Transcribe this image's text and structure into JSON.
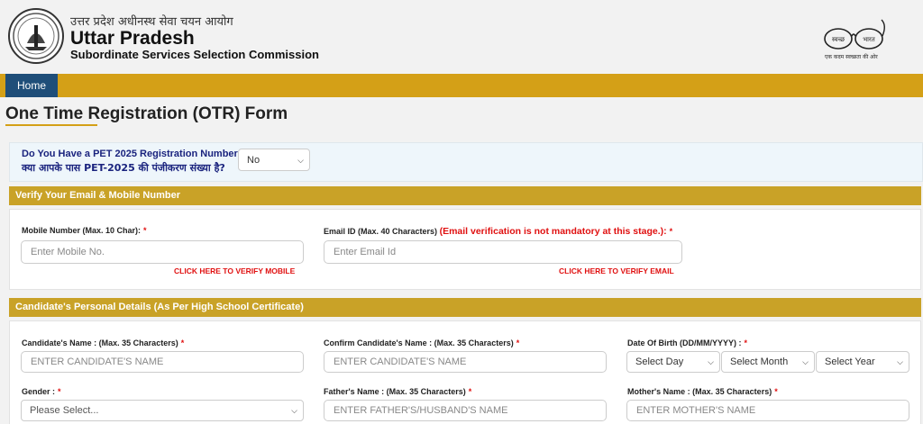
{
  "header": {
    "hindi_org": "उत्तर प्रदेश अधीनस्थ सेवा चयन आयोग",
    "title": "Uttar Pradesh",
    "subtitle": "Subordinate Services Selection Commission",
    "swachh_left": "स्वच्छ",
    "swachh_right": "भारत",
    "swachh_tagline": "एक कदम स्वच्छता की ओर"
  },
  "nav": {
    "home_label": "Home"
  },
  "page": {
    "title": "One Time Registration (OTR) Form"
  },
  "pet": {
    "question_en": "Do You Have a PET 2025 Registration Number?:",
    "question_hi": "क्या आपके पास PET-2025 की पंजीकरण संख्या है?",
    "selected": "No"
  },
  "verify_section": {
    "title": "Verify Your Email & Mobile Number",
    "mobile_label": "Mobile Number (Max. 10 Char):",
    "mobile_placeholder": "Enter Mobile No.",
    "mobile_verify_link": "CLICK HERE TO VERIFY MOBILE",
    "email_label": "Email ID (Max. 40 Characters)",
    "email_note": "(Email verification is not mandatory at this stage.):",
    "email_placeholder": "Enter Email Id",
    "email_verify_link": "CLICK HERE TO VERIFY EMAIL"
  },
  "personal_section": {
    "title": "Candidate's Personal Details (As Per High School Certificate)",
    "name_label": "Candidate's Name : (Max. 35 Characters)",
    "name_placeholder": "ENTER CANDIDATE'S NAME",
    "confirm_name_label": "Confirm Candidate's Name : (Max. 35 Characters)",
    "confirm_name_placeholder": "ENTER CANDIDATE'S NAME",
    "dob_label": "Date Of Birth (DD/MM/YYYY) :",
    "dob_day": "Select Day",
    "dob_month": "Select Month",
    "dob_year": "Select Year",
    "gender_label": "Gender :",
    "gender_selected": "Please Select...",
    "father_label": "Father's Name : (Max. 35 Characters)",
    "father_placeholder": "ENTER FATHER'S/HUSBAND'S NAME",
    "mother_label": "Mother's Name : (Max. 35 Characters)",
    "mother_placeholder": "ENTER MOTHER'S NAME"
  },
  "required_marker": "*",
  "colors": {
    "nav_bar": "#d4a017",
    "nav_home": "#1f4e79",
    "section_bar": "#c9a227",
    "required": "#e01010",
    "question_text": "#1a237e"
  }
}
